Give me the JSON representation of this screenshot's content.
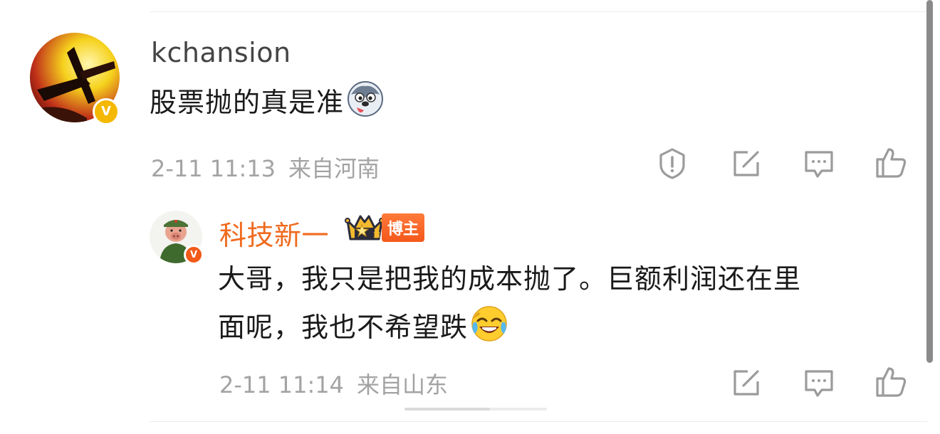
{
  "comments": [
    {
      "username": "kchansion",
      "text": "股票抛的真是准",
      "emoji": "husky-emoji",
      "time": "2-11 11:13",
      "location": "来自河南",
      "verified_mark": "V",
      "actions": [
        "report-icon",
        "repost-icon",
        "reply-icon",
        "like-icon"
      ]
    },
    {
      "username": "科技新一",
      "badge_label": "博主",
      "crown_level": "II",
      "text_line1": "大哥，我只是把我的成本抛了。巨额利润还在里",
      "text_line2": "面呢，我也不希望跌",
      "emoji": "laugh-cry-emoji",
      "time": "2-11 11:14",
      "location": "来自山东",
      "verified_mark": "V",
      "actions": [
        "repost-icon",
        "reply-icon",
        "like-icon"
      ]
    }
  ],
  "colors": {
    "username_gray": "#444444",
    "username_orange": "#f06a1d",
    "meta_gray": "#a3a3a3",
    "verified_yellow": "#f5b800",
    "verified_red": "#f25a18",
    "icon_gray": "#9b9b9b"
  }
}
